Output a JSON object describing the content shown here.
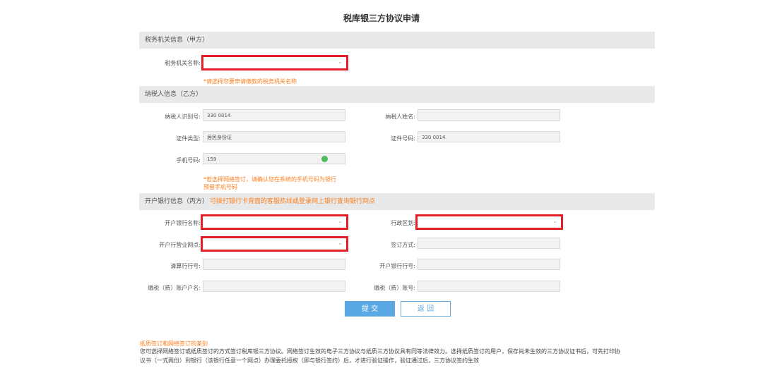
{
  "page": {
    "title": "税库银三方协议申请"
  },
  "section_a": {
    "title": "税务机关信息（甲方）",
    "tax_office_label": "税务机关名称:",
    "tax_office_hint": "*请选择您要申请缴款的税务机关名称"
  },
  "section_b": {
    "title": "纳税人信息（乙方）",
    "taxpayer_id_label": "纳税人识别号:",
    "taxpayer_id_value": "330                0014",
    "taxpayer_name_label": "纳税人姓名:",
    "taxpayer_name_value": "",
    "cert_type_label": "证件类型:",
    "cert_type_value": "居民身份证",
    "cert_no_label": "证件号码:",
    "cert_no_value": "330                0014",
    "phone_label": "手机号码:",
    "phone_value": "159",
    "phone_hint_line1": "*若选择网络签订，请确认您在系统的手机号码为银行",
    "phone_hint_line2": "预留手机号码"
  },
  "section_c": {
    "title": "开户银行信息（丙方）",
    "note": "可拨打银行卡背面的客服热线或登录网上银行查询银行网点",
    "bank_name_label": "开户银行名称:",
    "region_label": "行政区划:",
    "branch_label": "开户行营业网点:",
    "sign_method_label": "签订方式:",
    "clearing_bank_label": "清算行行号:",
    "bank_code_label": "开户银行行号:",
    "account_name_label": "缴税（费）账户户名:",
    "account_no_label": "缴税（费）账号:"
  },
  "buttons": {
    "submit": "提 交",
    "back": "返 回"
  },
  "info": {
    "title": "纸质签订和网络签订的差别",
    "line1": "您可选择网络签订或纸质签订的方式签订税库银三方协议。网络签订生效的电子三方协议与纸质三方协议具有同等法律效力。选择纸质签订的用户，保存尚未生效的三方协议证书后，可先打印协",
    "line2": "议书（一式两份）到银行（该银行任意一个网点）办理委托授权（即与银行签约）后，才进行验证操作，验证通过后，三方协议签约生效"
  },
  "colors": {
    "accent": "#5aa8e4",
    "warning": "#ff7e1b",
    "highlight": "#e41e26",
    "success": "#4cbb5c"
  }
}
